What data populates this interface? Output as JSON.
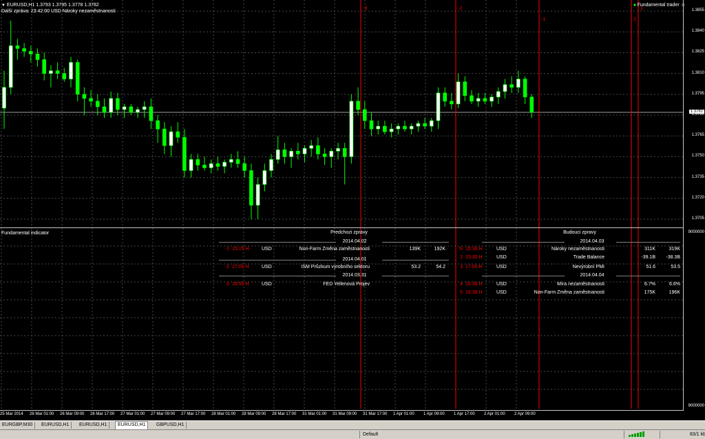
{
  "header": {
    "symbol_line": "EURUSD,H1  1.3793 1.3795 1.3778 1.3782",
    "next_news": "Další zpráva: 23:42:00 USD Nároky nezaměstnanosti",
    "indicator_name": "Fundamental trader",
    "smiley": "☺"
  },
  "indicator": {
    "title": "Fundamental indicator"
  },
  "chart_data": {
    "type": "candlestick",
    "symbol": "EURUSD",
    "timeframe": "H1",
    "price_axis": {
      "labels": [
        "1.3855",
        "1.3840",
        "1.3825",
        "1.3810",
        "1.3795",
        "1.3782",
        "1.3780",
        "1.3765",
        "1.3750",
        "1.3735",
        "1.3720",
        "1.3705"
      ],
      "current": "1.3782",
      "ylim": [
        1.37,
        1.386
      ]
    },
    "indicator_axis": {
      "top": "9000000",
      "bottom": "9000000"
    },
    "time_labels": [
      "25 Mar 2014",
      "26 Mar 01:00",
      "26 Mar 09:00",
      "26 Mar 17:00",
      "27 Mar 01:00",
      "27 Mar 09:00",
      "27 Mar 17:00",
      "28 Mar 01:00",
      "28 Mar 09:00",
      "28 Mar 17:00",
      "31 Mar 01:00",
      "31 Mar 09:00",
      "31 Mar 17:00",
      "1 Apr 01:00",
      "1 Apr 09:00",
      "1 Apr 17:00",
      "2 Apr 01:00",
      "2 Apr 09:00"
    ],
    "vertical_markers": [
      {
        "label": "-3"
      },
      {
        "label": "-2"
      },
      {
        "label": "-1"
      },
      {
        "label": "2"
      },
      {
        "label": "1"
      }
    ],
    "candles": [
      [
        1.3785,
        1.3812,
        1.377,
        1.38
      ],
      [
        1.38,
        1.3848,
        1.3795,
        1.383
      ],
      [
        1.383,
        1.3835,
        1.382,
        1.3828
      ],
      [
        1.3828,
        1.3832,
        1.3822,
        1.3826
      ],
      [
        1.3826,
        1.383,
        1.3818,
        1.3824
      ],
      [
        1.3824,
        1.3828,
        1.3815,
        1.382
      ],
      [
        1.382,
        1.3825,
        1.3805,
        1.381
      ],
      [
        1.381,
        1.3816,
        1.38,
        1.3812
      ],
      [
        1.3812,
        1.3818,
        1.3806,
        1.381
      ],
      [
        1.381,
        1.3814,
        1.3804,
        1.3806
      ],
      [
        1.3806,
        1.3822,
        1.38,
        1.3818
      ],
      [
        1.3818,
        1.382,
        1.379,
        1.3795
      ],
      [
        1.3795,
        1.38,
        1.378,
        1.3792
      ],
      [
        1.3792,
        1.3798,
        1.3786,
        1.379
      ],
      [
        1.379,
        1.3795,
        1.378,
        1.3786
      ],
      [
        1.3786,
        1.3792,
        1.3778,
        1.3782
      ],
      [
        1.3782,
        1.3797,
        1.3778,
        1.3792
      ],
      [
        1.3792,
        1.3796,
        1.378,
        1.3784
      ],
      [
        1.3784,
        1.3788,
        1.3778,
        1.3786
      ],
      [
        1.3786,
        1.3788,
        1.378,
        1.3782
      ],
      [
        1.3782,
        1.3786,
        1.3778,
        1.3784
      ],
      [
        1.3784,
        1.379,
        1.3778,
        1.3786
      ],
      [
        1.3786,
        1.3792,
        1.377,
        1.3776
      ],
      [
        1.3776,
        1.378,
        1.376,
        1.377
      ],
      [
        1.377,
        1.3775,
        1.3752,
        1.3758
      ],
      [
        1.3758,
        1.3772,
        1.375,
        1.3768
      ],
      [
        1.3768,
        1.3775,
        1.376,
        1.3764
      ],
      [
        1.3764,
        1.377,
        1.3735,
        1.374
      ],
      [
        1.374,
        1.3752,
        1.3735,
        1.3748
      ],
      [
        1.3748,
        1.3752,
        1.374,
        1.3744
      ],
      [
        1.3744,
        1.375,
        1.374,
        1.3742
      ],
      [
        1.3742,
        1.3748,
        1.3738,
        1.3745
      ],
      [
        1.3745,
        1.375,
        1.374,
        1.3743
      ],
      [
        1.3743,
        1.3748,
        1.3738,
        1.3746
      ],
      [
        1.3746,
        1.3752,
        1.3742,
        1.3748
      ],
      [
        1.3748,
        1.3754,
        1.3742,
        1.3745
      ],
      [
        1.3745,
        1.375,
        1.3735,
        1.374
      ],
      [
        1.374,
        1.3745,
        1.3705,
        1.3715
      ],
      [
        1.3715,
        1.3735,
        1.3705,
        1.373
      ],
      [
        1.373,
        1.3745,
        1.3725,
        1.374
      ],
      [
        1.374,
        1.3752,
        1.3735,
        1.3748
      ],
      [
        1.3748,
        1.3765,
        1.3745,
        1.3755
      ],
      [
        1.3755,
        1.376,
        1.3745,
        1.375
      ],
      [
        1.375,
        1.3756,
        1.3742,
        1.3754
      ],
      [
        1.3754,
        1.376,
        1.3748,
        1.3752
      ],
      [
        1.3752,
        1.3758,
        1.3746,
        1.3756
      ],
      [
        1.3756,
        1.3762,
        1.375,
        1.3758
      ],
      [
        1.3758,
        1.3764,
        1.3748,
        1.3752
      ],
      [
        1.3752,
        1.3756,
        1.3744,
        1.375
      ],
      [
        1.375,
        1.3756,
        1.3742,
        1.3754
      ],
      [
        1.3754,
        1.376,
        1.3748,
        1.3756
      ],
      [
        1.3756,
        1.376,
        1.373,
        1.375
      ],
      [
        1.375,
        1.3795,
        1.3745,
        1.379
      ],
      [
        1.379,
        1.38,
        1.378,
        1.3784
      ],
      [
        1.3784,
        1.379,
        1.377,
        1.3776
      ],
      [
        1.3776,
        1.3782,
        1.3765,
        1.377
      ],
      [
        1.377,
        1.3776,
        1.3766,
        1.3772
      ],
      [
        1.3772,
        1.3776,
        1.3766,
        1.3768
      ],
      [
        1.3768,
        1.3774,
        1.3764,
        1.377
      ],
      [
        1.377,
        1.3774,
        1.3766,
        1.3772
      ],
      [
        1.3772,
        1.3776,
        1.3768,
        1.377
      ],
      [
        1.377,
        1.3774,
        1.3766,
        1.3772
      ],
      [
        1.3772,
        1.3776,
        1.3768,
        1.3774
      ],
      [
        1.3774,
        1.3778,
        1.377,
        1.3772
      ],
      [
        1.3772,
        1.3778,
        1.3768,
        1.3776
      ],
      [
        1.3776,
        1.38,
        1.377,
        1.3796
      ],
      [
        1.3796,
        1.38,
        1.3786,
        1.379
      ],
      [
        1.379,
        1.3796,
        1.3784,
        1.3788
      ],
      [
        1.3788,
        1.381,
        1.3785,
        1.3804
      ],
      [
        1.3804,
        1.3808,
        1.379,
        1.3794
      ],
      [
        1.3794,
        1.3798,
        1.3788,
        1.379
      ],
      [
        1.379,
        1.3796,
        1.3786,
        1.3792
      ],
      [
        1.3792,
        1.3796,
        1.3788,
        1.379
      ],
      [
        1.379,
        1.3795,
        1.3786,
        1.3793
      ],
      [
        1.3793,
        1.38,
        1.3788,
        1.3797
      ],
      [
        1.3797,
        1.3806,
        1.3792,
        1.3802
      ],
      [
        1.3802,
        1.3808,
        1.3796,
        1.38
      ],
      [
        1.38,
        1.3812,
        1.3796,
        1.3806
      ],
      [
        1.3806,
        1.3808,
        1.3788,
        1.3793
      ],
      [
        1.3793,
        1.3795,
        1.3778,
        1.3782
      ]
    ]
  },
  "news": {
    "prev_title": "Predchozi zpravy",
    "next_title": "Budouci zpravy",
    "prev_dates": [
      "2014.04.02",
      "2014.04.01",
      "2014.03.31"
    ],
    "next_dates": [
      "2014.04.03",
      "2014.04.04"
    ],
    "prev_rows": [
      {
        "idx": "-1",
        "time": "15:15 H",
        "cur": "USD",
        "name": "Non-Farm Změna zaměstnanosti",
        "act": "139K",
        "fore": "192K"
      },
      {
        "idx": "-2",
        "time": "17:00 H",
        "cur": "USD",
        "name": "ISM Průzkum výrobního sektoru",
        "act": "53.2",
        "fore": "54.2"
      },
      {
        "idx": "-3",
        "time": "16:55 H",
        "cur": "USD",
        "name": "FED Yellenová Projev",
        "act": "",
        "fore": ""
      }
    ],
    "next_rows": [
      {
        "idx": "N",
        "time": "15:30 H",
        "cur": "USD",
        "name": "Nároky nezaměstnanosti",
        "act": "311K",
        "fore": "319K"
      },
      {
        "idx": "2",
        "time": "15:30 H",
        "cur": "USD",
        "name": "Trade Balance",
        "act": "-39.1B",
        "fore": "-38.3B"
      },
      {
        "idx": "3",
        "time": "17:00 H",
        "cur": "USD",
        "name": "Nevýrobní PMI",
        "act": "51.6",
        "fore": "53.5"
      },
      {
        "idx": "4",
        "time": "15:30 H",
        "cur": "USD",
        "name": "Míra nezaměstnanosti",
        "act": "6.7%",
        "fore": "6.6%"
      },
      {
        "idx": "5",
        "time": "15:30 H",
        "cur": "USD",
        "name": "Non-Farm Změna zaměstnanosti",
        "act": "175K",
        "fore": "196K"
      }
    ]
  },
  "tabs": [
    {
      "label": "EURGBP,M30",
      "active": false
    },
    {
      "label": "EURUSD,H1",
      "active": false
    },
    {
      "label": "EURUSD,H1",
      "active": false
    },
    {
      "label": "EURUSD,H1",
      "active": true
    },
    {
      "label": "GBPUSD,H1",
      "active": false
    }
  ],
  "status": {
    "profile": "Default",
    "traffic": "83/1 kb"
  },
  "colors": {
    "bull": "#ffffff",
    "bear": "#00ff00",
    "marker": "#ff0000",
    "grid": "#4a4a4a"
  }
}
